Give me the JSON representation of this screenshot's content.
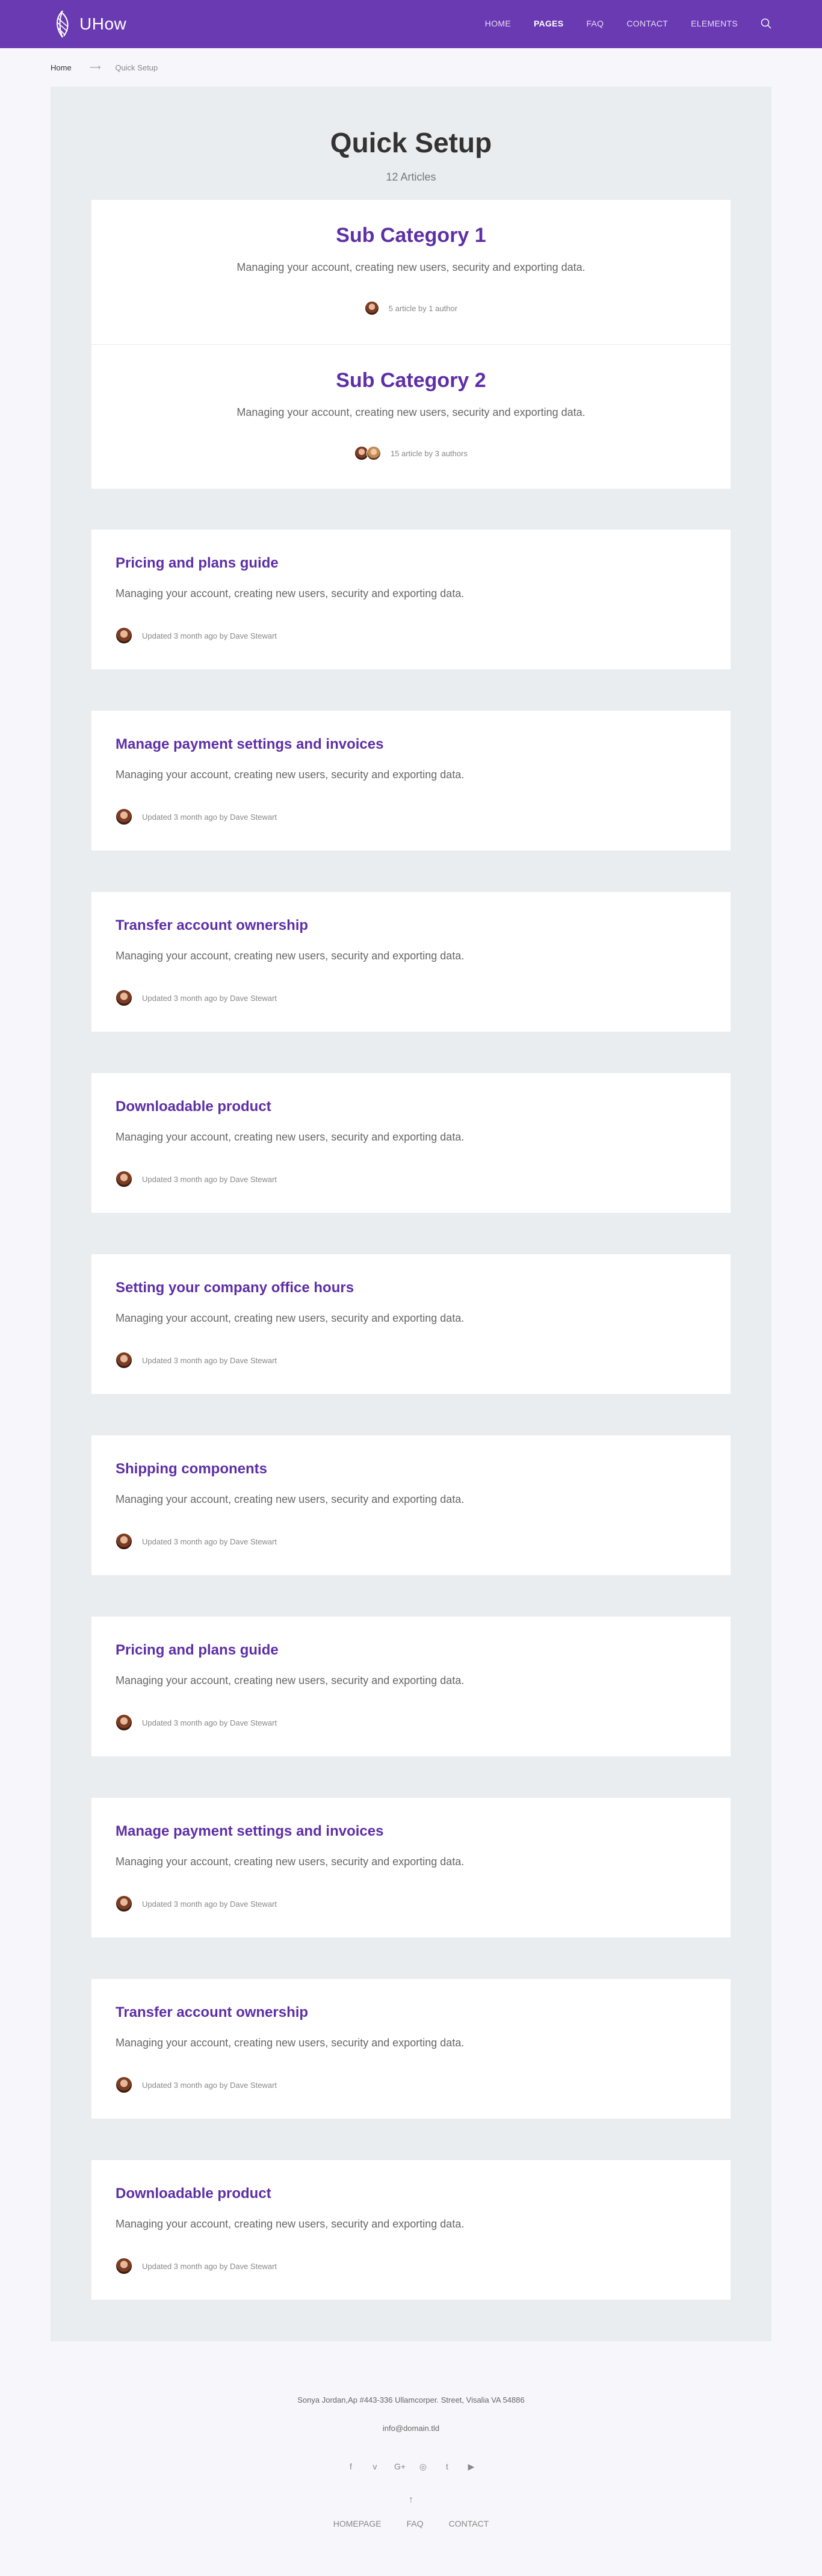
{
  "header": {
    "brand": "UHow",
    "nav": [
      "HOME",
      "PAGES",
      "FAQ",
      "CONTACT",
      "ELEMENTS"
    ],
    "active_nav": "PAGES",
    "brand_color": "#6a3ab2"
  },
  "breadcrumb": {
    "home": "Home",
    "arrow": "⟶",
    "current": "Quick Setup"
  },
  "page": {
    "title": "Quick Setup",
    "subtitle": "12 Articles"
  },
  "subcategories": [
    {
      "title": "Sub Category 1",
      "description": "Managing your account, creating new users, security and exporting data.",
      "meta": "5 article by 1 author",
      "avatar_count": 1
    },
    {
      "title": "Sub Category 2",
      "description": "Managing your account, creating new users, security and exporting data.",
      "meta": "15 article by 3 authors",
      "avatar_count": 2
    }
  ],
  "articles": [
    {
      "title": "Pricing and plans guide",
      "description": "Managing your account, creating new users, security and exporting data.",
      "meta": "Updated 3 month ago by Dave Stewart"
    },
    {
      "title": "Manage payment settings and invoices",
      "description": "Managing your account, creating new users, security and exporting data.",
      "meta": "Updated 3 month ago by Dave Stewart"
    },
    {
      "title": "Transfer account ownership",
      "description": "Managing your account, creating new users, security and exporting data.",
      "meta": "Updated 3 month ago by Dave Stewart"
    },
    {
      "title": "Downloadable product",
      "description": "Managing your account, creating new users, security and exporting data.",
      "meta": "Updated 3 month ago by Dave Stewart"
    },
    {
      "title": "Setting your company office hours",
      "description": "Managing your account, creating new users, security and exporting data.",
      "meta": "Updated 3 month ago by Dave Stewart"
    },
    {
      "title": "Shipping components",
      "description": "Managing your account, creating new users, security and exporting data.",
      "meta": "Updated 3 month ago by Dave Stewart"
    },
    {
      "title": "Pricing and plans guide",
      "description": "Managing your account, creating new users, security and exporting data.",
      "meta": "Updated 3 month ago by Dave Stewart"
    },
    {
      "title": "Manage payment settings and invoices",
      "description": "Managing your account, creating new users, security and exporting data.",
      "meta": "Updated 3 month ago by Dave Stewart"
    },
    {
      "title": "Transfer account ownership",
      "description": "Managing your account, creating new users, security and exporting data.",
      "meta": "Updated 3 month ago by Dave Stewart"
    },
    {
      "title": "Downloadable product",
      "description": "Managing your account, creating new users, security and exporting data.",
      "meta": "Updated 3 month ago by Dave Stewart"
    }
  ],
  "footer": {
    "address": "Sonya Jordan,Ap #443-336 Ullamcorper. Street, Visalia VA 54886",
    "email": "info@domain.tld",
    "socials": [
      "facebook-icon",
      "vimeo-icon",
      "google-plus-icon",
      "instagram-icon",
      "twitter-icon",
      "youtube-icon"
    ],
    "social_glyphs": [
      "f",
      "v",
      "G+",
      "◎",
      "t",
      "▶"
    ],
    "up_glyph": "↑",
    "nav": [
      "HOMEPAGE",
      "FAQ",
      "CONTACT"
    ]
  }
}
